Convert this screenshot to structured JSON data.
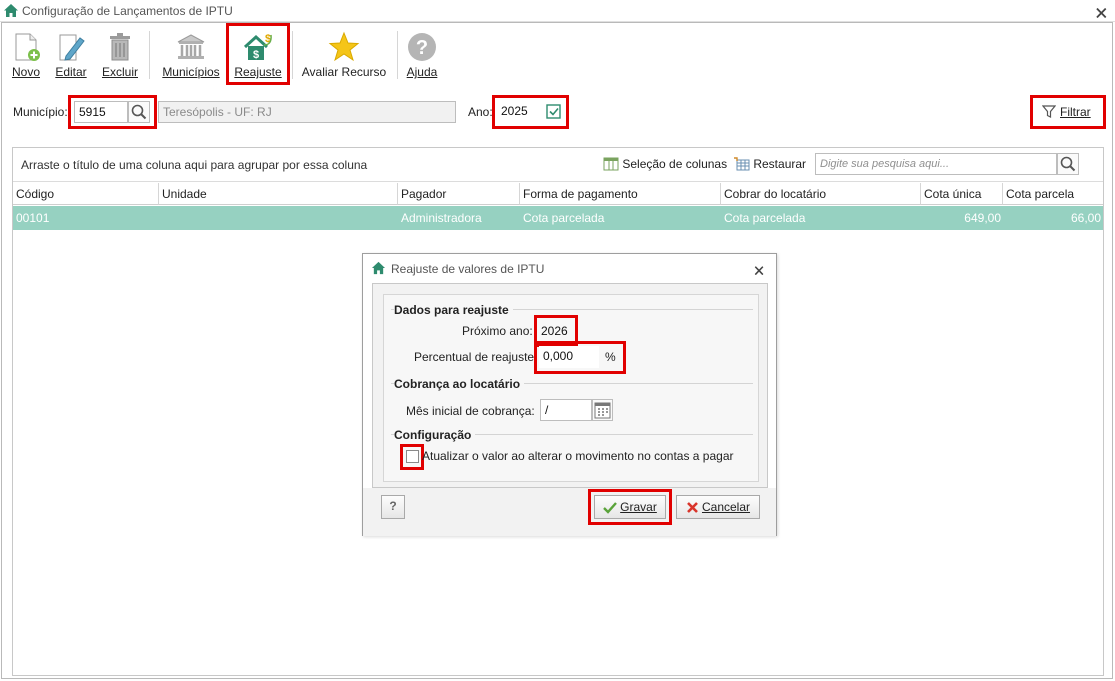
{
  "window": {
    "title": "Configuração de Lançamentos de IPTU",
    "close_glyph": "🗙"
  },
  "toolbar": {
    "items": [
      {
        "label": "Novo",
        "icon": "new-document-icon"
      },
      {
        "label": "Editar",
        "icon": "edit-pencil-icon"
      },
      {
        "label": "Excluir",
        "icon": "trash-icon"
      },
      {
        "label": "Municípios",
        "icon": "city-hall-icon"
      },
      {
        "label": "Reajuste",
        "icon": "house-money-icon"
      },
      {
        "label": "Avaliar Recurso",
        "icon": "star-icon"
      },
      {
        "label": "Ajuda",
        "icon": "help-icon"
      }
    ]
  },
  "filters": {
    "municipio_label": "Município:",
    "municipio_code": "5915",
    "municipio_name": "Teresópolis - UF: RJ",
    "ano_label": "Ano:",
    "ano_value": "2025",
    "filtrar_label": "Filtrar"
  },
  "grid": {
    "group_hint": "Arraste o título de uma coluna aqui para agrupar por essa coluna",
    "column_selection_label": "Seleção de colunas",
    "restore_label": "Restaurar",
    "search_placeholder": "Digite sua pesquisa aqui...",
    "columns": [
      "Código",
      "Unidade",
      "Pagador",
      "Forma de pagamento",
      "Cobrar do locatário",
      "Cota única",
      "Cota parcela"
    ],
    "rows": [
      [
        "00101",
        "",
        "Administradora",
        "Cota parcelada",
        "Cota parcelada",
        "649,00",
        "66,00"
      ]
    ]
  },
  "dialog": {
    "title": "Reajuste de valores de IPTU",
    "section1_title": "Dados para reajuste",
    "proximo_ano_label": "Próximo ano:",
    "proximo_ano_value": "2026",
    "percentual_label": "Percentual de reajuste:",
    "percentual_value": "0,000",
    "percent_symbol": "%",
    "section2_title": "Cobrança ao locatário",
    "mes_inicial_label": "Mês inicial de cobrança:",
    "mes_inicial_value": "/",
    "section3_title": "Configuração",
    "checkbox_label": "Atualizar o valor ao alterar o movimento no contas a pagar",
    "help_glyph": "?",
    "save_label": "Gravar",
    "cancel_label": "Cancelar"
  },
  "colors": {
    "accent": "#2e8b6e",
    "row_selected": "#96d1c1",
    "highlight": "#e10000"
  }
}
